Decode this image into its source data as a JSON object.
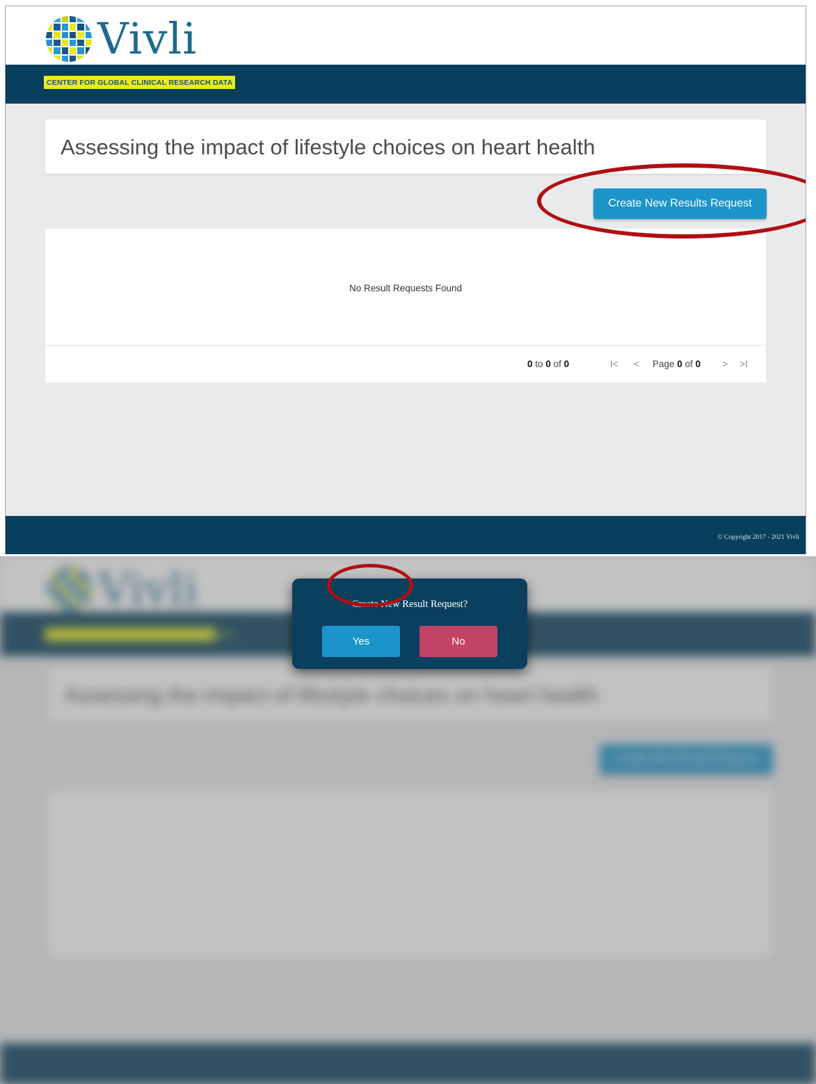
{
  "brand": {
    "name": "Vivli",
    "tagline": "CENTER FOR GLOBAL CLINICAL RESEARCH DATA",
    "primary_color": "#073f5c",
    "accent_color": "#1b95c9",
    "tagline_bg": "#e8ec1a"
  },
  "page": {
    "title": "Assessing the impact of lifestyle choices on heart health",
    "create_button": "Create New Results Request",
    "empty_message": "No Result Requests Found"
  },
  "pager": {
    "range_from": "0",
    "range_to_word": "to",
    "range_to": "0",
    "of_word": "of",
    "range_total": "0",
    "page_word": "Page",
    "page_current": "0",
    "page_total": "0",
    "first_icon": "first-page-icon",
    "prev_icon": "previous-page-icon",
    "next_icon": "next-page-icon",
    "last_icon": "last-page-icon"
  },
  "footer": {
    "copyright": "© Copyright 2017 - 2021 Vivli"
  },
  "dialog": {
    "question": "Create New Result Request?",
    "yes_label": "Yes",
    "no_label": "No",
    "yes_color": "#1b95c9",
    "no_color": "#c24364"
  },
  "annotations": {
    "highlight_color": "#b00f12"
  }
}
